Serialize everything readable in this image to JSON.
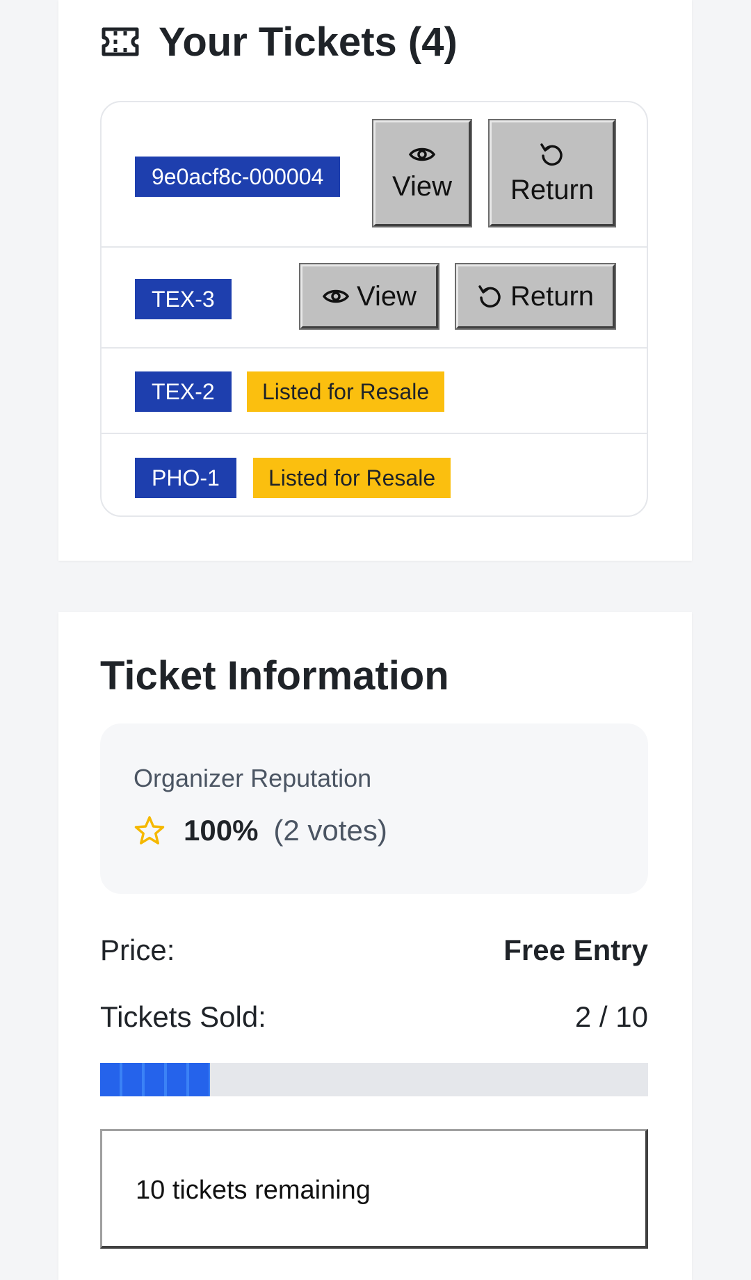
{
  "tickets_section": {
    "title": "Your Tickets (4)",
    "tickets": [
      {
        "id": "9e0acf8c-000004",
        "view_label": "View",
        "return_label": "Return"
      },
      {
        "id": "TEX-3",
        "view_label": "View",
        "return_label": "Return"
      },
      {
        "id": "TEX-2",
        "status": "Listed for Resale"
      },
      {
        "id": "PHO-1",
        "status": "Listed for Resale"
      }
    ]
  },
  "info_section": {
    "title": "Ticket Information",
    "reputation": {
      "label": "Organizer Reputation",
      "percent": "100%",
      "votes": "(2 votes)"
    },
    "price_label": "Price:",
    "price_value": "Free Entry",
    "sold_label": "Tickets Sold:",
    "sold_value": "2 / 10",
    "sold_fraction": 0.2,
    "remaining": "10 tickets remaining"
  },
  "colors": {
    "badge_blue": "#1e3fae",
    "badge_yellow": "#fbbf0f",
    "progress_blue": "#2563eb",
    "star": "#f5b800"
  },
  "icons": {
    "tickets_title": "ticket-icon",
    "view": "eye-icon",
    "return": "undo-icon",
    "reputation": "star-icon"
  }
}
